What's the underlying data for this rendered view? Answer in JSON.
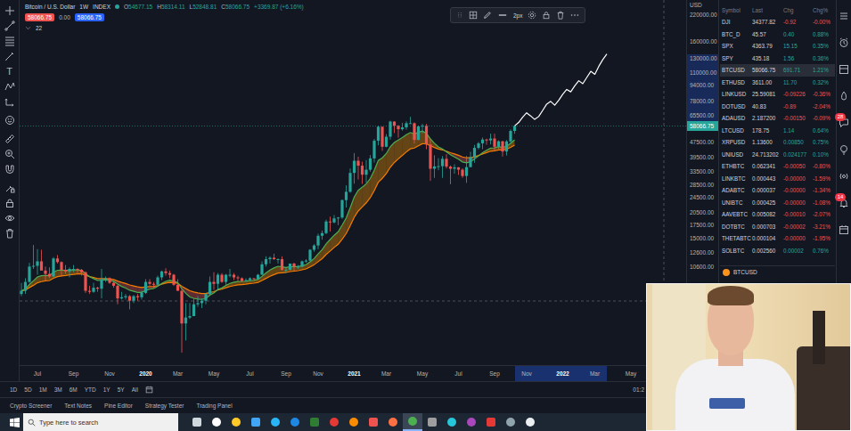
{
  "left_toolbar": {
    "text_tool": "T"
  },
  "chart": {
    "title": "Bitcoin / U.S. Dollar",
    "interval": "1W",
    "exchange": "INDEX",
    "ohlc": [
      {
        "label": "O",
        "value": "54677.15"
      },
      {
        "label": "H",
        "value": "58314.11"
      },
      {
        "label": "L",
        "value": "52848.81"
      },
      {
        "label": "C",
        "value": "58066.75"
      }
    ],
    "change": "+3369.87 (+6.16%)",
    "quote": {
      "bid": "58066.75",
      "spread": "0.00",
      "ask": "58066.75"
    },
    "indicator_value": "22",
    "drawing_toolbar": {
      "line_width": "2px"
    },
    "price_axis": {
      "currency": "USD",
      "ticks": [
        "220000.00",
        "160000.00",
        "130000.00",
        "110000.00",
        "94000.00",
        "78000.00",
        "65500.00",
        "47500.00",
        "39500.00",
        "33500.00",
        "28500.00",
        "24500.00",
        "20500.00",
        "17500.00",
        "15000.00",
        "12600.00",
        "10600.00"
      ],
      "last_price": "58066.75"
    },
    "time_axis": {
      "ticks": [
        "Jul",
        "Sep",
        "Nov",
        "2020",
        "Mar",
        "May",
        "Jul",
        "Sep",
        "Nov",
        "2021",
        "Mar",
        "May",
        "Jul",
        "Sep",
        "Nov",
        "2022",
        "Mar",
        "May"
      ]
    },
    "candles": [
      [
        7700,
        8800,
        7500,
        8000
      ],
      [
        8000,
        9300,
        7700,
        8900
      ],
      [
        8900,
        11200,
        8800,
        10700
      ],
      [
        10700,
        13880,
        10400,
        10800
      ],
      [
        10800,
        13200,
        9700,
        11400
      ],
      [
        11400,
        13100,
        11000,
        10200
      ],
      [
        10200,
        10700,
        9100,
        9800
      ],
      [
        9800,
        10600,
        9300,
        9500
      ],
      [
        9500,
        12000,
        9400,
        11800
      ],
      [
        11800,
        12300,
        11100,
        11300
      ],
      [
        11300,
        11400,
        9500,
        10300
      ],
      [
        10300,
        10900,
        9800,
        10100
      ],
      [
        10100,
        10600,
        9400,
        10400
      ],
      [
        10400,
        10900,
        10000,
        10400
      ],
      [
        10400,
        10500,
        9900,
        10300
      ],
      [
        10300,
        10400,
        9600,
        10000
      ],
      [
        10000,
        10100,
        7800,
        8000
      ],
      [
        8000,
        8500,
        7700,
        7900
      ],
      [
        7900,
        8800,
        7800,
        8300
      ],
      [
        8300,
        8400,
        7900,
        8200
      ],
      [
        8200,
        10400,
        7300,
        9200
      ],
      [
        9200,
        9500,
        8900,
        9300
      ],
      [
        9300,
        9400,
        8700,
        8800
      ],
      [
        8800,
        9000,
        8300,
        8500
      ],
      [
        8500,
        8600,
        6800,
        7300
      ],
      [
        7300,
        7900,
        7200,
        7400
      ],
      [
        7400,
        7700,
        7200,
        7500
      ],
      [
        7500,
        7600,
        6400,
        7100
      ],
      [
        7100,
        7600,
        6900,
        7500
      ],
      [
        7500,
        7700,
        7100,
        7400
      ],
      [
        7400,
        8000,
        7200,
        7800
      ],
      [
        7800,
        9200,
        7700,
        8900
      ],
      [
        8900,
        9200,
        8500,
        8700
      ],
      [
        8700,
        8900,
        8300,
        8600
      ],
      [
        8600,
        9600,
        8500,
        9400
      ],
      [
        9400,
        10200,
        9100,
        10100
      ],
      [
        10100,
        10500,
        9600,
        9900
      ],
      [
        9900,
        10200,
        9300,
        9700
      ],
      [
        9700,
        9800,
        8500,
        8600
      ],
      [
        8600,
        9200,
        8000,
        8000
      ],
      [
        8000,
        8200,
        3800,
        5400
      ],
      [
        5400,
        6900,
        4400,
        5800
      ],
      [
        5800,
        6900,
        5700,
        5900
      ],
      [
        5900,
        7300,
        5900,
        6800
      ],
      [
        6800,
        7500,
        6600,
        6900
      ],
      [
        6900,
        7300,
        6500,
        7100
      ],
      [
        7100,
        7800,
        6800,
        7700
      ],
      [
        7700,
        9500,
        7600,
        8900
      ],
      [
        8900,
        10000,
        8100,
        8700
      ],
      [
        8700,
        9900,
        8100,
        9700
      ],
      [
        9700,
        9900,
        8800,
        8900
      ],
      [
        8900,
        9800,
        8600,
        9700
      ],
      [
        9700,
        10400,
        9400,
        9700
      ],
      [
        9700,
        9900,
        9100,
        9400
      ],
      [
        9400,
        9600,
        9000,
        9300
      ],
      [
        9300,
        9400,
        8900,
        9000
      ],
      [
        9000,
        9300,
        8900,
        9100
      ],
      [
        9100,
        9400,
        9000,
        9300
      ],
      [
        9300,
        9300,
        9100,
        9200
      ],
      [
        9200,
        9800,
        9100,
        9700
      ],
      [
        9700,
        11400,
        9700,
        11000
      ],
      [
        11000,
        12100,
        10700,
        11700
      ],
      [
        11700,
        12100,
        11100,
        11900
      ],
      [
        11900,
        12500,
        11600,
        11700
      ],
      [
        11700,
        11800,
        11100,
        11700
      ],
      [
        11700,
        12100,
        10200,
        10300
      ],
      [
        10300,
        10600,
        9900,
        10300
      ],
      [
        10300,
        11100,
        10200,
        11100
      ],
      [
        11100,
        11200,
        10200,
        10700
      ],
      [
        10700,
        10900,
        10400,
        10700
      ],
      [
        10700,
        11500,
        10600,
        11400
      ],
      [
        11400,
        11700,
        11200,
        11500
      ],
      [
        11500,
        13200,
        11400,
        13100
      ],
      [
        13100,
        14000,
        12800,
        13800
      ],
      [
        13800,
        15900,
        13200,
        15500
      ],
      [
        15500,
        16500,
        14800,
        16000
      ],
      [
        16000,
        18800,
        15800,
        18400
      ],
      [
        18400,
        19500,
        16300,
        18200
      ],
      [
        18200,
        19900,
        18000,
        19100
      ],
      [
        19100,
        19400,
        17600,
        19300
      ],
      [
        19300,
        24000,
        19000,
        23800
      ],
      [
        23800,
        28400,
        21800,
        26300
      ],
      [
        26300,
        34800,
        26000,
        33000
      ],
      [
        33000,
        41900,
        29000,
        38200
      ],
      [
        38200,
        40100,
        30500,
        36000
      ],
      [
        36000,
        37800,
        28900,
        32300
      ],
      [
        32300,
        38500,
        29300,
        34300
      ],
      [
        34300,
        40900,
        33500,
        39300
      ],
      [
        39300,
        49700,
        37400,
        48600
      ],
      [
        48600,
        58300,
        46000,
        57500
      ],
      [
        57500,
        57500,
        43000,
        45200
      ],
      [
        45200,
        52600,
        44900,
        51000
      ],
      [
        51000,
        61800,
        49200,
        61200
      ],
      [
        61200,
        61300,
        53300,
        58100
      ],
      [
        58100,
        58700,
        50400,
        55800
      ],
      [
        55800,
        60300,
        54900,
        57100
      ],
      [
        57100,
        61300,
        55500,
        60000
      ],
      [
        60000,
        64800,
        59700,
        60000
      ],
      [
        60000,
        60500,
        47000,
        49100
      ],
      [
        49100,
        58400,
        48800,
        57800
      ],
      [
        57800,
        59600,
        53000,
        58200
      ],
      [
        58200,
        59500,
        43900,
        46400
      ],
      [
        46400,
        49800,
        30000,
        34700
      ],
      [
        34700,
        40800,
        31100,
        35700
      ],
      [
        35700,
        39400,
        34100,
        35800
      ],
      [
        35800,
        40400,
        31100,
        39100
      ],
      [
        39100,
        41300,
        34800,
        35600
      ],
      [
        35600,
        36100,
        28800,
        34700
      ],
      [
        34700,
        36600,
        32700,
        35300
      ],
      [
        35300,
        35400,
        32200,
        34300
      ],
      [
        34300,
        34900,
        31100,
        31800
      ],
      [
        31800,
        40500,
        29300,
        35400
      ],
      [
        35400,
        42600,
        35300,
        39900
      ],
      [
        39900,
        46200,
        37300,
        44600
      ],
      [
        44600,
        47900,
        43800,
        47100
      ],
      [
        47100,
        50500,
        43900,
        49300
      ],
      [
        49300,
        49800,
        46300,
        48800
      ],
      [
        48800,
        52900,
        46500,
        49900
      ],
      [
        49900,
        52900,
        42800,
        45200
      ],
      [
        45200,
        48800,
        44000,
        48300
      ],
      [
        48300,
        48400,
        40200,
        42700
      ],
      [
        42700,
        49000,
        40700,
        48200
      ],
      [
        48200,
        55700,
        47200,
        54677.15
      ],
      [
        54677.15,
        58314.11,
        52848.81,
        58066.75
      ]
    ],
    "projection": [
      60500,
      64500,
      68000,
      65500,
      62800,
      65000,
      70000,
      75500,
      78000,
      74500,
      79000,
      85000,
      90000,
      87500,
      94000,
      100000,
      96500,
      104000,
      112000,
      108000,
      119000,
      129000,
      138000
    ]
  },
  "watchlist": {
    "columns": [
      "Symbol",
      "Last",
      "Chg",
      "Chg%"
    ],
    "rows": [
      {
        "symbol": "DJI",
        "last": "34377.82",
        "chg": "-0.92",
        "chg_pct": "-0.00%",
        "up": false,
        "selected": false
      },
      {
        "symbol": "BTC_D",
        "last": "45.57",
        "chg": "0.40",
        "chg_pct": "0.88%",
        "up": true,
        "selected": false
      },
      {
        "symbol": "SPX",
        "last": "4363.79",
        "chg": "15.15",
        "chg_pct": "0.35%",
        "up": true,
        "selected": false
      },
      {
        "symbol": "SPY",
        "last": "435.18",
        "chg": "1.56",
        "chg_pct": "0.36%",
        "up": true,
        "selected": false
      },
      {
        "symbol": "BTCUSD",
        "last": "58066.75",
        "chg": "691.71",
        "chg_pct": "1.21%",
        "up": true,
        "selected": true
      },
      {
        "symbol": "ETHUSD",
        "last": "3611.00",
        "chg": "11.70",
        "chg_pct": "0.32%",
        "up": true,
        "selected": false
      },
      {
        "symbol": "LINKUSD",
        "last": "25.59081",
        "chg": "-0.09226",
        "chg_pct": "-0.36%",
        "up": false,
        "selected": false
      },
      {
        "symbol": "DOTUSD",
        "last": "40.83",
        "chg": "-0.89",
        "chg_pct": "-2.04%",
        "up": false,
        "selected": false
      },
      {
        "symbol": "ADAUSD",
        "last": "2.187200",
        "chg": "-0.00150",
        "chg_pct": "-0.09%",
        "up": false,
        "selected": false
      },
      {
        "symbol": "LTCUSD",
        "last": "178.75",
        "chg": "1.14",
        "chg_pct": "0.64%",
        "up": true,
        "selected": false
      },
      {
        "symbol": "XRPUSD",
        "last": "1.13600",
        "chg": "0.00850",
        "chg_pct": "0.75%",
        "up": true,
        "selected": false
      },
      {
        "symbol": "UNIUSD",
        "last": "24.713202",
        "chg": "0.024177",
        "chg_pct": "0.10%",
        "up": true,
        "selected": false
      },
      {
        "symbol": "ETHBTC",
        "last": "0.062341",
        "chg": "-0.00050",
        "chg_pct": "-0.80%",
        "up": false,
        "selected": false
      },
      {
        "symbol": "LINKBTC",
        "last": "0.000443",
        "chg": "-0.00000",
        "chg_pct": "-1.59%",
        "up": false,
        "selected": false
      },
      {
        "symbol": "ADABTC",
        "last": "0.000037",
        "chg": "-0.00000",
        "chg_pct": "-1.34%",
        "up": false,
        "selected": false
      },
      {
        "symbol": "UNIBTC",
        "last": "0.000425",
        "chg": "-0.00000",
        "chg_pct": "-1.08%",
        "up": false,
        "selected": false
      },
      {
        "symbol": "AAVEBTC",
        "last": "0.005082",
        "chg": "-0.00010",
        "chg_pct": "-2.07%",
        "up": false,
        "selected": false
      },
      {
        "symbol": "DOTBTC",
        "last": "0.000703",
        "chg": "-0.00002",
        "chg_pct": "-3.21%",
        "up": false,
        "selected": false
      },
      {
        "symbol": "THETABTC",
        "last": "0.000104",
        "chg": "-0.00000",
        "chg_pct": "-1.95%",
        "up": false,
        "selected": false
      },
      {
        "symbol": "SOLBTC",
        "last": "0.002560",
        "chg": "0.00002",
        "chg_pct": "0.76%",
        "up": true,
        "selected": false
      }
    ],
    "details": {
      "symbol": "BTCUSD"
    }
  },
  "right_strip": {
    "badges": [
      "28",
      "14"
    ]
  },
  "range_bar": {
    "ranges": [
      {
        "label": "1D",
        "selected": false
      },
      {
        "label": "5D",
        "selected": false
      },
      {
        "label": "1M",
        "selected": false
      },
      {
        "label": "3M",
        "selected": false
      },
      {
        "label": "6M",
        "selected": false
      },
      {
        "label": "YTD",
        "selected": false
      },
      {
        "label": "1Y",
        "selected": false
      },
      {
        "label": "5Y",
        "selected": false
      },
      {
        "label": "All",
        "selected": false
      }
    ],
    "time": "01:2"
  },
  "bottom_tabs": [
    {
      "label": "Crypto Screener",
      "selected": false
    },
    {
      "label": "Text Notes",
      "selected": false
    },
    {
      "label": "Pine Editor",
      "selected": false
    },
    {
      "label": "Strategy Tester",
      "selected": false
    },
    {
      "label": "Trading Panel",
      "selected": false
    }
  ],
  "taskbar": {
    "search": {
      "placeholder": "Type here to search"
    },
    "apps": [
      {
        "selected": false
      },
      {
        "selected": false
      },
      {
        "selected": false
      },
      {
        "selected": false
      },
      {
        "selected": false
      },
      {
        "selected": false
      },
      {
        "selected": false
      },
      {
        "selected": false
      },
      {
        "selected": false
      },
      {
        "selected": false
      },
      {
        "selected": false
      },
      {
        "selected": true
      },
      {
        "selected": false
      },
      {
        "selected": false
      },
      {
        "selected": false
      },
      {
        "selected": false
      },
      {
        "selected": false
      },
      {
        "selected": false
      }
    ]
  }
}
